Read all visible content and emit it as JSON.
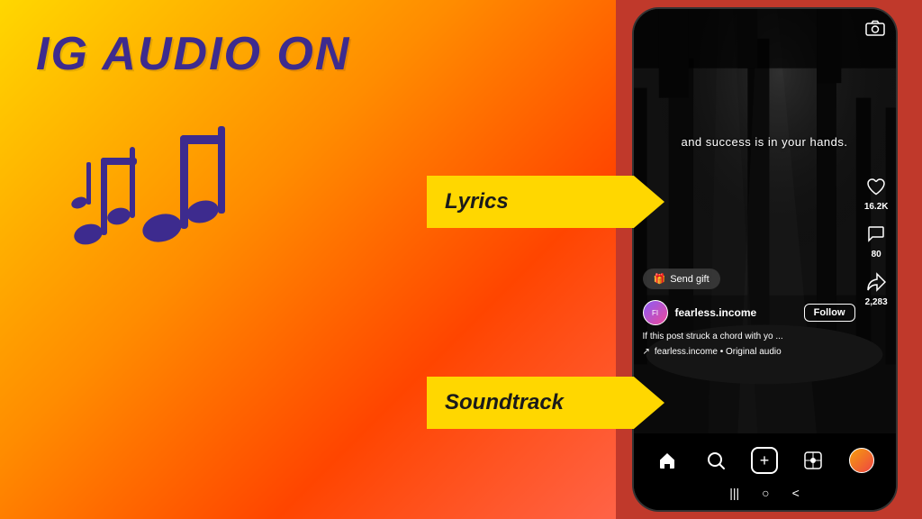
{
  "left": {
    "title": "IG AUDIO ON",
    "music_notes": "♩♫♪",
    "arrows": {
      "lyrics": "Lyrics",
      "soundtrack": "Soundtrack"
    }
  },
  "phone": {
    "lyrics_text": "and success is in your hands.",
    "send_gift_label": "Send gift",
    "username": "fearless.income",
    "follow_label": "Follow",
    "caption": "If this post struck a chord with yo ...",
    "soundtrack_arrow": "↗",
    "soundtrack_text": "fearless.income • Original audio",
    "like_count": "16.2K",
    "comment_count": "80",
    "share_count": "2,283",
    "nav": {
      "home": "⌂",
      "search": "⌕",
      "add": "+",
      "reels": "▶",
      "avatar": ""
    },
    "system_buttons": {
      "menu": "|||",
      "home": "○",
      "back": "<"
    }
  }
}
